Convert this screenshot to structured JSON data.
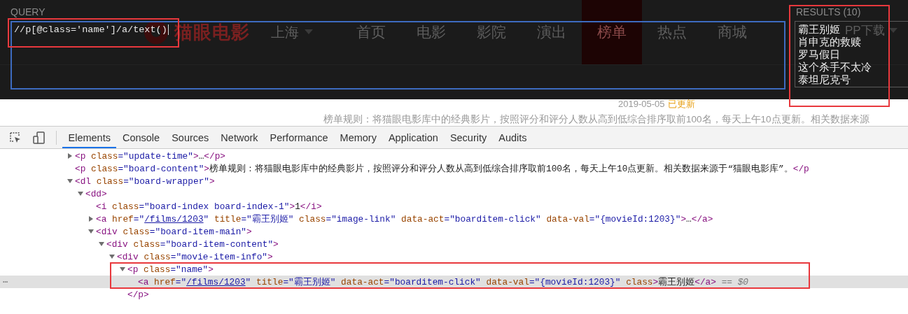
{
  "page_behind": {
    "logo": "猫眼电影",
    "city": "上海",
    "nav": [
      {
        "label": "首页",
        "selected": false
      },
      {
        "label": "电影",
        "selected": false
      },
      {
        "label": "影院",
        "selected": false
      },
      {
        "label": "演出",
        "selected": false
      },
      {
        "label": "榜单",
        "selected": true
      },
      {
        "label": "热点",
        "selected": false
      },
      {
        "label": "商城",
        "selected": false
      }
    ],
    "app_download": "PP下载",
    "date": "2019-05-05",
    "updated": "已更新",
    "board_rule": "榜单规则：将猫眼电影库中的经典影片，按照评分和评分人数从高到低综合排序取前100名，每天上午10点更新。相关数据来源"
  },
  "xpath_helper": {
    "query_label": "QUERY",
    "query": "//p[@class='name']/a/text()",
    "query_highlighted": true,
    "results_label": "RESULTS (10)",
    "results_highlighted": true,
    "results": [
      "霸王别姬",
      "肖申克的救赎",
      "罗马假日",
      "这个杀手不太冷",
      "泰坦尼克号"
    ]
  },
  "devtools": {
    "tabs": [
      {
        "label": "Elements",
        "selected": true
      },
      {
        "label": "Console",
        "selected": false
      },
      {
        "label": "Sources",
        "selected": false
      },
      {
        "label": "Network",
        "selected": false
      },
      {
        "label": "Performance",
        "selected": false
      },
      {
        "label": "Memory",
        "selected": false
      },
      {
        "label": "Application",
        "selected": false
      },
      {
        "label": "Security",
        "selected": false
      },
      {
        "label": "Audits",
        "selected": false
      }
    ],
    "elements": [
      {
        "kind": "collapsed",
        "selected": false,
        "highlighted": false,
        "parts": [
          {
            "kind": "tag",
            "text": "<p"
          },
          {
            "kind": "attr",
            "text": " class"
          },
          {
            "kind": "value",
            "text": "=\"update-time\""
          },
          {
            "kind": "tag",
            "text": ">"
          },
          {
            "kind": "text",
            "text": "…"
          },
          {
            "kind": "tag",
            "text": "</p>"
          }
        ]
      },
      {
        "kind": "leaf",
        "selected": false,
        "highlighted": false,
        "parts": [
          {
            "kind": "tag",
            "text": "<p"
          },
          {
            "kind": "attr",
            "text": " class"
          },
          {
            "kind": "value",
            "text": "=\"board-content\""
          },
          {
            "kind": "tag",
            "text": ">"
          },
          {
            "kind": "text",
            "text": "榜单规则：将猫眼电影库中的经典影片，按照评分和评分人数从高到低综合排序取前100名，每天上午10点更新。相关数据来源于“猫眼电影库”。"
          },
          {
            "kind": "tag",
            "text": "</p"
          }
        ]
      },
      {
        "kind": "expanded",
        "selected": false,
        "highlighted": false,
        "parts": [
          {
            "kind": "tag",
            "text": "<dl"
          },
          {
            "kind": "attr",
            "text": " class"
          },
          {
            "kind": "value",
            "text": "=\"board-wrapper\""
          },
          {
            "kind": "tag",
            "text": ">"
          }
        ],
        "children": [
          {
            "kind": "expanded",
            "selected": false,
            "highlighted": false,
            "parts": [
              {
                "kind": "tag",
                "text": "<dd>"
              }
            ],
            "children": [
              {
                "kind": "leaf",
                "selected": false,
                "highlighted": false,
                "parts": [
                  {
                    "kind": "tag",
                    "text": "<i"
                  },
                  {
                    "kind": "attr",
                    "text": " class"
                  },
                  {
                    "kind": "value",
                    "text": "=\"board-index board-index-1\""
                  },
                  {
                    "kind": "tag",
                    "text": ">"
                  },
                  {
                    "kind": "text",
                    "text": "1"
                  },
                  {
                    "kind": "tag",
                    "text": "</i>"
                  }
                ]
              },
              {
                "kind": "collapsed",
                "selected": false,
                "highlighted": false,
                "parts": [
                  {
                    "kind": "tag",
                    "text": "<a"
                  },
                  {
                    "kind": "attr",
                    "text": " href"
                  },
                  {
                    "kind": "value",
                    "text": "=\""
                  },
                  {
                    "kind": "link",
                    "text": "/films/1203"
                  },
                  {
                    "kind": "value",
                    "text": "\""
                  },
                  {
                    "kind": "attr",
                    "text": " title"
                  },
                  {
                    "kind": "value",
                    "text": "=\"霸王别姬\""
                  },
                  {
                    "kind": "attr",
                    "text": " class"
                  },
                  {
                    "kind": "value",
                    "text": "=\"image-link\""
                  },
                  {
                    "kind": "attr",
                    "text": " data-act"
                  },
                  {
                    "kind": "value",
                    "text": "=\"boarditem-click\""
                  },
                  {
                    "kind": "attr",
                    "text": " data-val"
                  },
                  {
                    "kind": "value",
                    "text": "=\"{movieId:1203}\""
                  },
                  {
                    "kind": "tag",
                    "text": ">"
                  },
                  {
                    "kind": "text",
                    "text": "…"
                  },
                  {
                    "kind": "tag",
                    "text": "</a>"
                  }
                ]
              },
              {
                "kind": "expanded",
                "selected": false,
                "highlighted": false,
                "parts": [
                  {
                    "kind": "tag",
                    "text": "<div"
                  },
                  {
                    "kind": "attr",
                    "text": " class"
                  },
                  {
                    "kind": "value",
                    "text": "=\"board-item-main\""
                  },
                  {
                    "kind": "tag",
                    "text": ">"
                  }
                ],
                "children": [
                  {
                    "kind": "expanded",
                    "selected": false,
                    "highlighted": false,
                    "parts": [
                      {
                        "kind": "tag",
                        "text": "<div"
                      },
                      {
                        "kind": "attr",
                        "text": " class"
                      },
                      {
                        "kind": "value",
                        "text": "=\"board-item-content\""
                      },
                      {
                        "kind": "tag",
                        "text": ">"
                      }
                    ],
                    "children": [
                      {
                        "kind": "expanded",
                        "selected": false,
                        "highlighted": false,
                        "parts": [
                          {
                            "kind": "tag",
                            "text": "<div"
                          },
                          {
                            "kind": "attr",
                            "text": " class"
                          },
                          {
                            "kind": "value",
                            "text": "=\"movie-item-info\""
                          },
                          {
                            "kind": "tag",
                            "text": ">"
                          }
                        ],
                        "children": [
                          {
                            "kind": "expanded",
                            "selected": false,
                            "highlighted": true,
                            "parts": [
                              {
                                "kind": "tag",
                                "text": "<p"
                              },
                              {
                                "kind": "attr",
                                "text": " class"
                              },
                              {
                                "kind": "value",
                                "text": "=\"name\""
                              },
                              {
                                "kind": "tag",
                                "text": ">"
                              }
                            ],
                            "closing": "</p>",
                            "children": [
                              {
                                "kind": "leaf",
                                "selected": true,
                                "highlighted": false,
                                "more": "⋯",
                                "parts": [
                                  {
                                    "kind": "tag",
                                    "text": "<a"
                                  },
                                  {
                                    "kind": "attr",
                                    "text": " href"
                                  },
                                  {
                                    "kind": "value",
                                    "text": "=\""
                                  },
                                  {
                                    "kind": "link",
                                    "text": "/films/1203"
                                  },
                                  {
                                    "kind": "value",
                                    "text": "\""
                                  },
                                  {
                                    "kind": "attr",
                                    "text": " title"
                                  },
                                  {
                                    "kind": "value",
                                    "text": "=\"霸王别姬\""
                                  },
                                  {
                                    "kind": "attr",
                                    "text": " data-act"
                                  },
                                  {
                                    "kind": "value",
                                    "text": "=\"boarditem-click\""
                                  },
                                  {
                                    "kind": "attr",
                                    "text": " data-val"
                                  },
                                  {
                                    "kind": "value",
                                    "text": "=\"{movieId:1203}\""
                                  },
                                  {
                                    "kind": "attr",
                                    "text": " class"
                                  },
                                  {
                                    "kind": "tag",
                                    "text": ">"
                                  },
                                  {
                                    "kind": "text",
                                    "text": "霸王别姬"
                                  },
                                  {
                                    "kind": "tag",
                                    "text": "</a>"
                                  },
                                  {
                                    "kind": "marker",
                                    "text": " == *$0*"
                                  }
                                ]
                              }
                            ]
                          }
                        ]
                      }
                    ]
                  }
                ]
              }
            ]
          }
        ]
      }
    ]
  }
}
